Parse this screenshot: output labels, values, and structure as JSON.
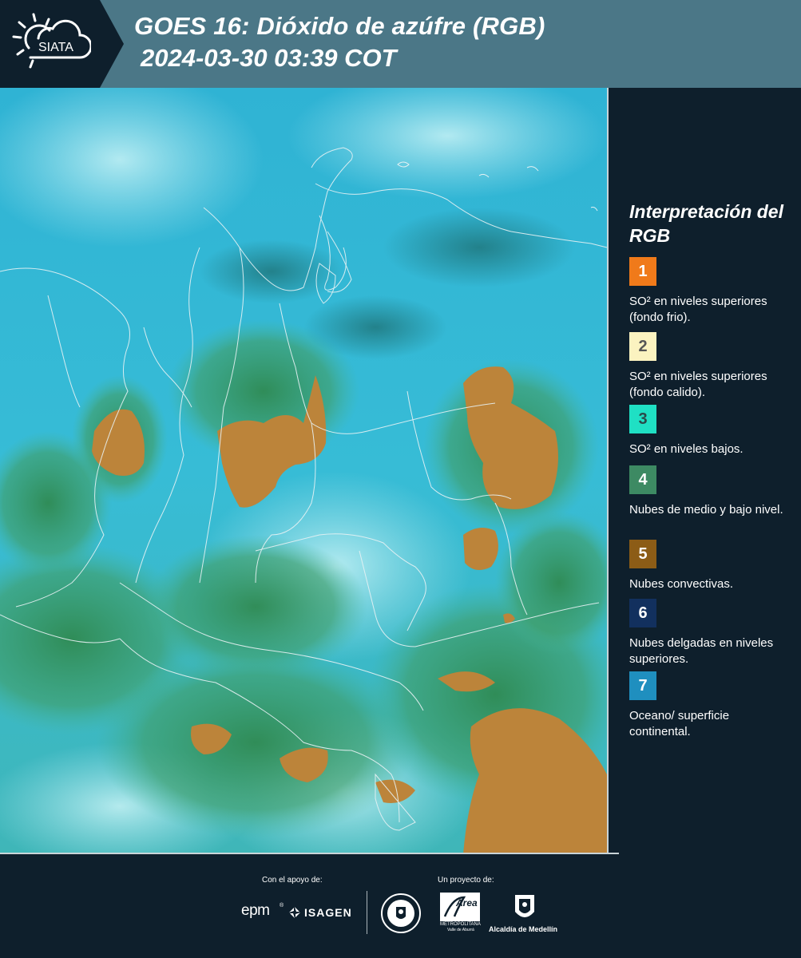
{
  "header": {
    "logo_text": "SIATA",
    "title_line1": "GOES 16: Dióxido de azúfre (RGB)",
    "title_line2": "2024-03-30 03:39 COT"
  },
  "map": {
    "description_icon": "satellite-rgb-map",
    "colors": {
      "ocean": "#2fb6d6",
      "low_clouds": "#3f9a6a",
      "convective": "#b07a35",
      "outline": "#e8f2f4"
    }
  },
  "legend": {
    "title": "Interpretación del RGB",
    "items": [
      {
        "number": "1",
        "color": "#f07a1a",
        "text_color": "#ffffff",
        "label": "SO² en niveles superiores (fondo frio)."
      },
      {
        "number": "2",
        "color": "#fbf3c0",
        "text_color": "#555555",
        "label": "SO² en niveles superiores (fondo calido)."
      },
      {
        "number": "3",
        "color": "#1fe0c4",
        "text_color": "#2a4a4a",
        "label": "SO² en niveles bajos."
      },
      {
        "number": "4",
        "color": "#3d8a63",
        "text_color": "#ffffff",
        "label": "Nubes de medio y bajo nivel."
      },
      {
        "number": "5",
        "color": "#8c5c16",
        "text_color": "#ffffff",
        "label": "Nubes convectivas."
      },
      {
        "number": "6",
        "color": "#12305e",
        "text_color": "#ffffff",
        "label": "Nubes delgadas en niveles superiores."
      },
      {
        "number": "7",
        "color": "#1f8fbf",
        "text_color": "#ffffff",
        "label": "Oceano/ superficie continental."
      }
    ]
  },
  "footer": {
    "support_label": "Con el apoyo de:",
    "project_label": "Un proyecto de:",
    "epm": "epm",
    "isagen": "ISAGEN",
    "area_metro": "Área",
    "area_metro_sub": "METROPOLITANA",
    "area_metro_sub2": "Valle de Aburrá",
    "alcaldia": "Alcaldía de Medellín"
  }
}
